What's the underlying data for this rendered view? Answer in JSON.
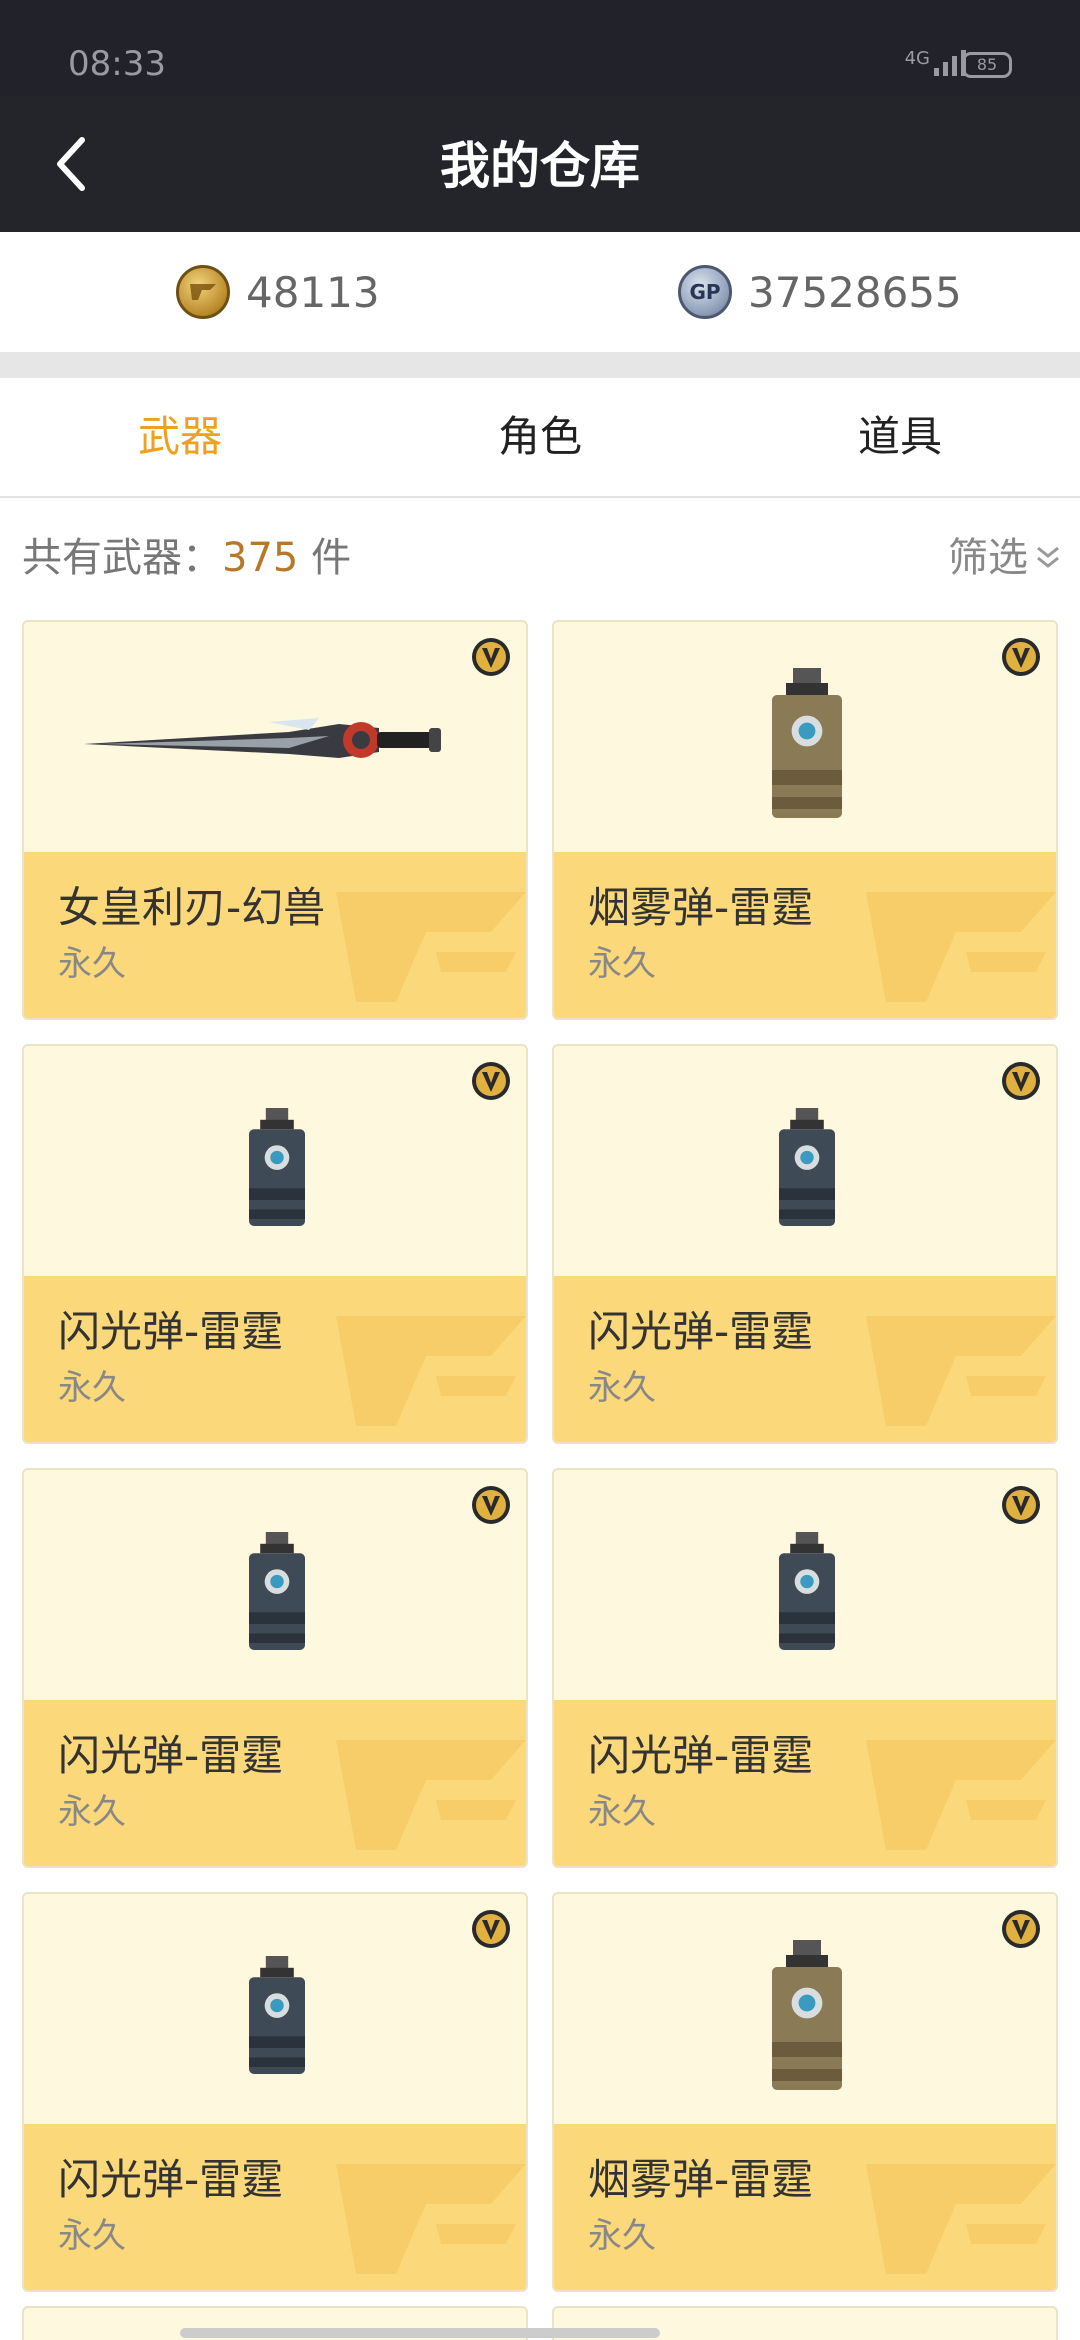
{
  "status_bar": {
    "time": "08:33",
    "network": "4G",
    "battery": "85"
  },
  "header": {
    "title": "我的仓库",
    "back_icon": "chevron-left-icon"
  },
  "currency": {
    "cf_points": "48113",
    "gp_points": "37528655",
    "gp_label": "GP"
  },
  "tabs": [
    {
      "label": "武器",
      "active": true
    },
    {
      "label": "角色",
      "active": false
    },
    {
      "label": "道具",
      "active": false
    }
  ],
  "summary": {
    "prefix": "共有武器：",
    "count": "375",
    "suffix": " 件",
    "filter_label": "筛选"
  },
  "items": [
    {
      "name": "女皇利刃-幻兽",
      "duration": "永久",
      "icon": "sword-icon"
    },
    {
      "name": "烟雾弹-雷霆",
      "duration": "永久",
      "icon": "smoke-grenade-icon"
    },
    {
      "name": "闪光弹-雷霆",
      "duration": "永久",
      "icon": "flash-grenade-icon"
    },
    {
      "name": "闪光弹-雷霆",
      "duration": "永久",
      "icon": "flash-grenade-icon"
    },
    {
      "name": "闪光弹-雷霆",
      "duration": "永久",
      "icon": "flash-grenade-icon"
    },
    {
      "name": "闪光弹-雷霆",
      "duration": "永久",
      "icon": "flash-grenade-icon"
    },
    {
      "name": "闪光弹-雷霆",
      "duration": "永久",
      "icon": "flash-grenade-icon"
    },
    {
      "name": "烟雾弹-雷霆",
      "duration": "永久",
      "icon": "smoke-grenade-icon"
    }
  ],
  "colors": {
    "accent": "#f0a020",
    "card_top": "#fef8de",
    "card_bottom": "#fbd97a",
    "header_bg": "#24252b"
  }
}
